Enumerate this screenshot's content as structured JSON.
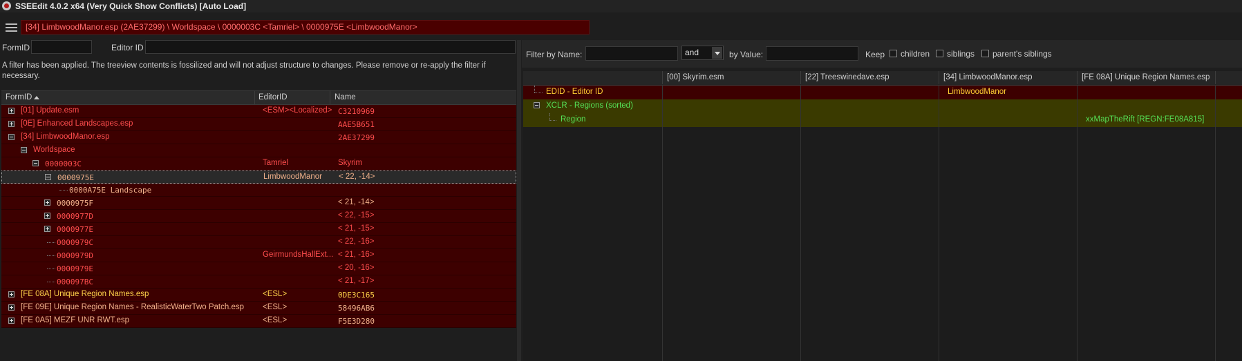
{
  "window": {
    "title": "SSEEdit 4.0.2 x64 (Very Quick Show Conflicts) [Auto Load]"
  },
  "path_bar": "[34] LimbwoodManor.esp (2AE37299) \\ Worldspace \\ 0000003C <Tamriel> \\ 0000975E <LimbwoodManor>",
  "left": {
    "formid_label": "FormID",
    "editorid_label": "Editor ID",
    "formid_value": "",
    "editorid_value": "",
    "filter_message": "A filter has been applied. The treeview contents is fossilized and will not adjust structure to changes.  Please remove or re-apply the filter if necessary.",
    "columns": [
      "FormID",
      "EditorID",
      "Name"
    ],
    "rows": [
      {
        "formid": "[01] Update.esm",
        "editorid": "<ESM><Localized>",
        "name": "C3210969"
      },
      {
        "formid": "[0E] Enhanced Landscapes.esp",
        "editorid": "",
        "name": "AAE5B651"
      },
      {
        "formid": "[34] LimbwoodManor.esp",
        "editorid": "",
        "name": "2AE37299"
      },
      {
        "formid": "Worldspace",
        "editorid": "",
        "name": ""
      },
      {
        "formid": "0000003C",
        "editorid": "Tamriel",
        "name": "Skyrim"
      },
      {
        "formid": "0000975E",
        "editorid": "LimbwoodManor",
        "name": "< 22, -14>"
      },
      {
        "formid": "0000A75E  Landscape",
        "editorid": "",
        "name": ""
      },
      {
        "formid": "0000975F",
        "editorid": "",
        "name": "< 21, -14>"
      },
      {
        "formid": "0000977D",
        "editorid": "",
        "name": "< 22, -15>"
      },
      {
        "formid": "0000977E",
        "editorid": "",
        "name": "< 21, -15>"
      },
      {
        "formid": "0000979C",
        "editorid": "",
        "name": "< 22, -16>"
      },
      {
        "formid": "0000979D",
        "editorid": "GeirmundsHallExt...",
        "name": "< 21, -16>"
      },
      {
        "formid": "0000979E",
        "editorid": "",
        "name": "< 20, -16>"
      },
      {
        "formid": "000097BC",
        "editorid": "",
        "name": "< 21, -17>"
      },
      {
        "formid": "[FE 08A] Unique Region Names.esp",
        "editorid": "<ESL>",
        "name": "0DE3C165"
      },
      {
        "formid": "[FE 09E] Unique Region Names - RealisticWaterTwo Patch.esp",
        "editorid": "<ESL>",
        "name": "58496AB6"
      },
      {
        "formid": "[FE 0A5] MEZF UNR RWT.esp",
        "editorid": "<ESL>",
        "name": "F5E3D280"
      }
    ]
  },
  "right": {
    "filter_by_name_label": "Filter by Name:",
    "and_value": "and",
    "by_value_label": "by Value:",
    "keep_label": "Keep",
    "children_label": "children",
    "siblings_label": "siblings",
    "parents_siblings_label": "parent's siblings",
    "columns": [
      "[00] Skyrim.esm",
      "[22] Treeswinedave.esp",
      "[34] LimbwoodManor.esp",
      "[FE 08A] Unique Region Names.esp"
    ],
    "rows": [
      {
        "label": "EDID - Editor ID",
        "values": [
          "",
          "",
          "LimbwoodManor",
          ""
        ]
      },
      {
        "label": "XCLR - Regions (sorted)",
        "values": [
          "",
          "",
          "",
          ""
        ]
      },
      {
        "label": "Region",
        "values": [
          "",
          "",
          "",
          "xxMapTheRift [REGN:FE08A815]"
        ]
      }
    ]
  }
}
